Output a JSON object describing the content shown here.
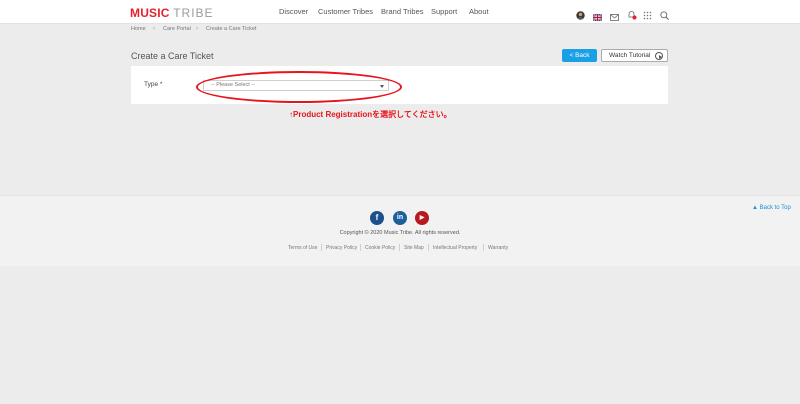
{
  "header": {
    "logo_music": "MUSIC",
    "logo_tribe": "TRIBE",
    "nav": [
      "Discover",
      "Customer Tribes",
      "Brand Tribes",
      "Support",
      "About"
    ],
    "icons": [
      "avatar-icon",
      "uk-flag-icon",
      "mail-icon",
      "notification-bell-icon",
      "apps-grid-icon",
      "search-icon"
    ]
  },
  "breadcrumb": [
    "Home",
    "Care Portal",
    "Create a Care Ticket"
  ],
  "main": {
    "title": "Create a Care Ticket",
    "back_button": "< Back",
    "tutorial_button": "Watch Tutorial",
    "type_label": "Type *",
    "type_select_value": "-- Please Select --"
  },
  "annotation": {
    "text": "↑Product Registrationを選択してください。",
    "color": "#e8141c"
  },
  "footer": {
    "back_to_top": "Back to Top",
    "social": [
      {
        "name": "facebook-icon",
        "glyph": "f",
        "color": "#1c4f8c"
      },
      {
        "name": "linkedin-icon",
        "glyph": "in",
        "color": "#1c5f9c"
      },
      {
        "name": "youtube-icon",
        "glyph": "▶",
        "color": "#b8191f"
      }
    ],
    "copyright": "Copyright © 2020 Music Tribe. All rights reserved.",
    "links": [
      "Terms of Use",
      "Privacy Policy",
      "Cookie Policy",
      "Site Map",
      "Intellectual Property",
      "Warranty"
    ]
  },
  "colors": {
    "brand_red": "#e4222d",
    "accent_blue": "#1aa0e6"
  }
}
